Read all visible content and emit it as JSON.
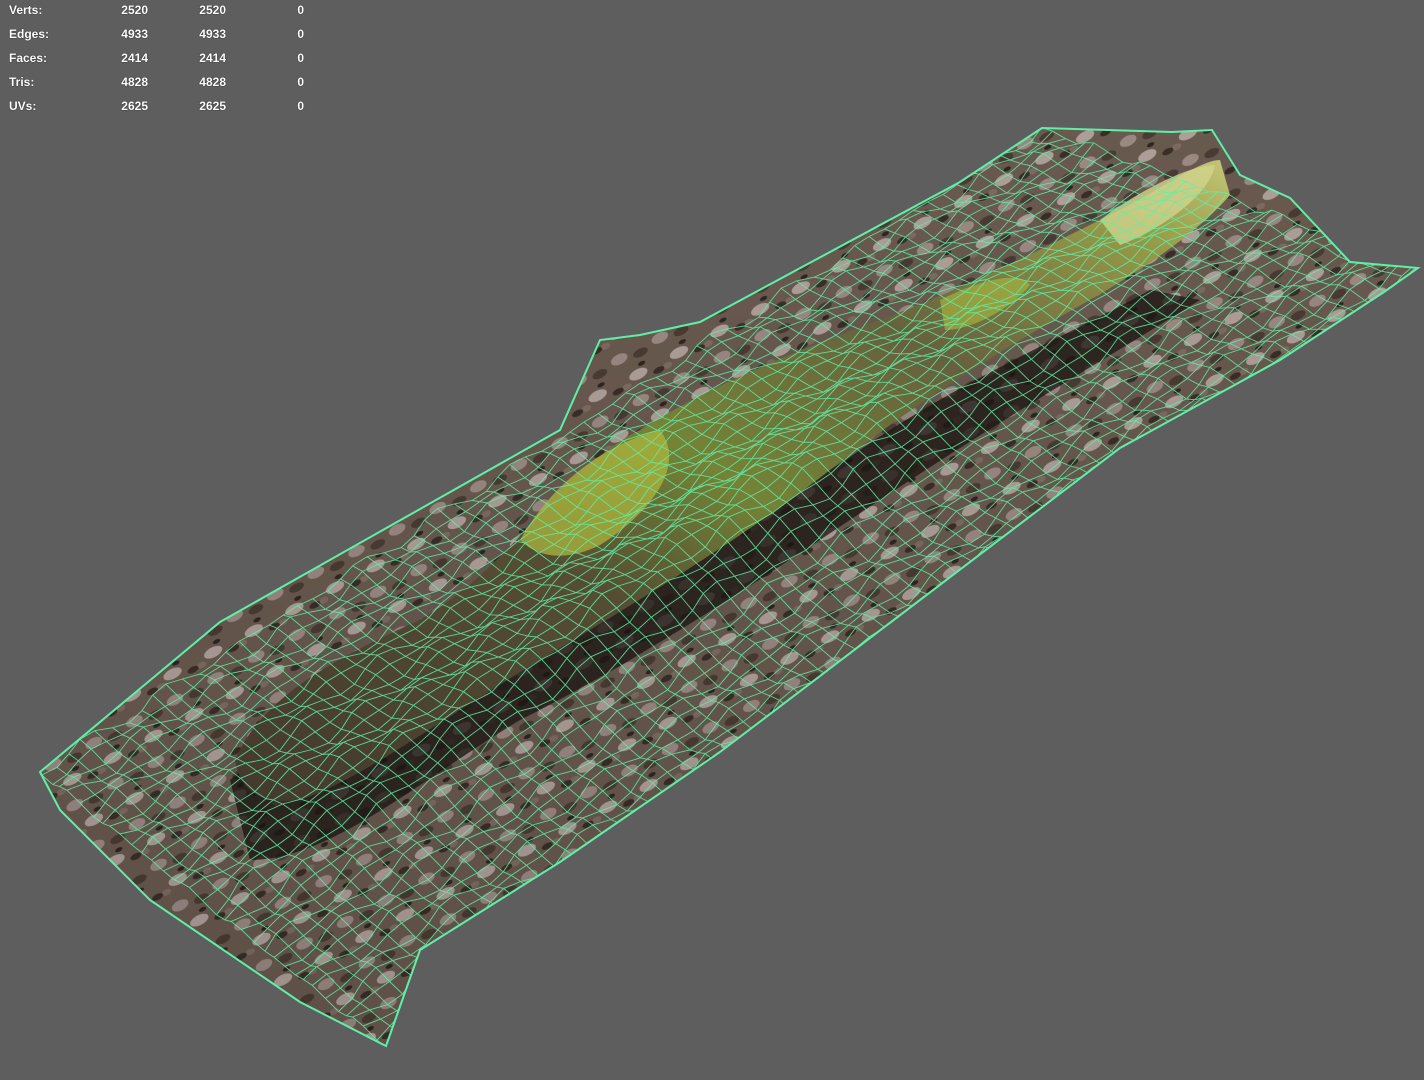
{
  "stats": {
    "rows": [
      {
        "label": "Verts:",
        "values": [
          "2520",
          "2520",
          "0"
        ]
      },
      {
        "label": "Edges:",
        "values": [
          "4933",
          "4933",
          "0"
        ]
      },
      {
        "label": "Faces:",
        "values": [
          "2414",
          "2414",
          "0"
        ]
      },
      {
        "label": "Tris:",
        "values": [
          "4828",
          "4828",
          "0"
        ]
      },
      {
        "label": "UVs:",
        "values": [
          "2625",
          "2625",
          "0"
        ]
      }
    ]
  },
  "viewport": {
    "background_color": "#5e5e5e",
    "wireframe_color": "#5ff0a8",
    "object": "textured scanned log mesh with wireframe overlay"
  }
}
